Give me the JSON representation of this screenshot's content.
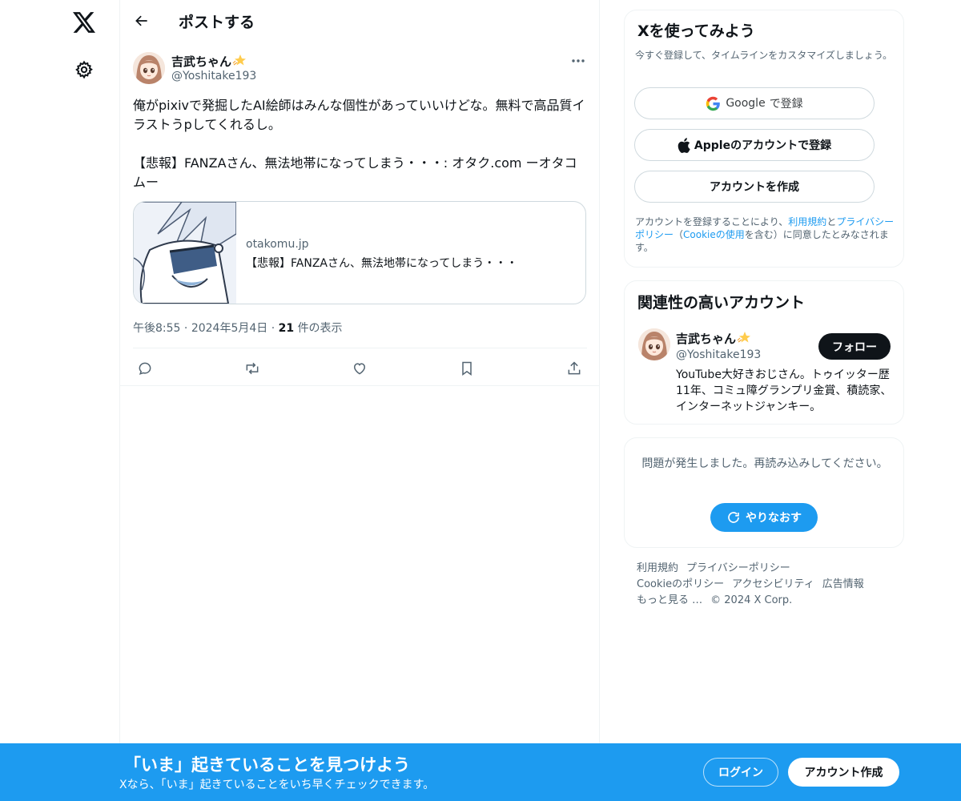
{
  "colors": {
    "accent": "#1d9bf0",
    "text_primary": "#0f1419",
    "text_secondary": "#536471",
    "border": "#eff3f4"
  },
  "nav": {
    "logo_icon": "x-logo-icon",
    "settings_icon": "gear-icon"
  },
  "header": {
    "back_icon": "arrow-left-icon",
    "title": "ポストする"
  },
  "post": {
    "author": {
      "name": "吉武ちゃん",
      "badge_icon": "sparkle-star-emoji",
      "handle": "@Yoshitake193"
    },
    "text": "俺がpixivで発掘したAI絵師はみんな個性があっていいけどな。無料で高品質イラストうpしてくれるし。\n\n【悲報】FANZAさん、無法地帯になってしまう・・・: オタク.com ーオタコムー",
    "card": {
      "domain": "otakomu.jp",
      "title": "【悲報】FANZAさん、無法地帯になってしまう・・・"
    },
    "meta": {
      "time": "午後8:55",
      "date": "2024年5月4日",
      "views_count": "21",
      "views_label": "件の表示"
    },
    "actions": [
      "reply-icon",
      "repost-icon",
      "like-icon",
      "bookmark-icon",
      "share-icon"
    ]
  },
  "signup": {
    "title": "Xを使ってみよう",
    "subtitle": "今すぐ登録して、タイムラインをカスタマイズしましょう。",
    "google_brand": "Google",
    "google_suffix": "で登録",
    "apple_label": "Appleのアカウントで登録",
    "create_label": "アカウントを作成",
    "terms_prefix": "アカウントを登録することにより、",
    "terms_link1": "利用規約",
    "terms_and": "と",
    "terms_link2": "プライバシーポリシー",
    "terms_paren_open": "（",
    "terms_link3": "Cookieの使用",
    "terms_suffix": "を含む）に同意したとみなされます。"
  },
  "related": {
    "title": "関連性の高いアカウント",
    "name": "吉武ちゃん",
    "handle": "@Yoshitake193",
    "follow_label": "フォロー",
    "bio": "YouTube大好きおじさん。トゥイッター歴11年、コミュ障グランプリ金賞、積読家、インターネットジャンキー。"
  },
  "error": {
    "message": "問題が発生しました。再読み込みしてください。",
    "retry_label": "やりなおす"
  },
  "footer": {
    "terms": "利用規約",
    "privacy": "プライバシーポリシー",
    "cookie": "Cookieのポリシー",
    "accessibility": "アクセシビリティ",
    "ads": "広告情報",
    "more": "もっと見る …",
    "copyright": "© 2024 X Corp."
  },
  "banner": {
    "title": "「いま」起きていることを見つけよう",
    "subtitle": "Xなら、「いま」起きていることをいち早くチェックできます。",
    "login_label": "ログイン",
    "create_label": "アカウント作成"
  }
}
